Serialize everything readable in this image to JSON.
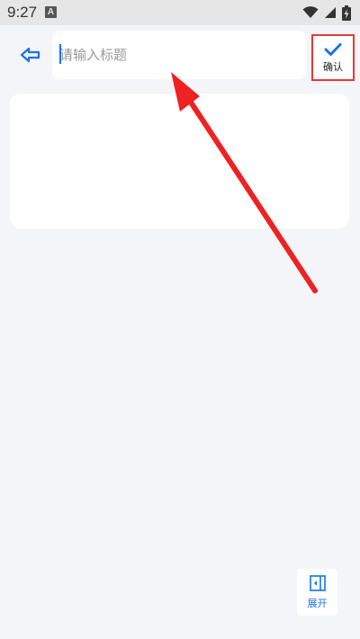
{
  "status_bar": {
    "time": "9:27",
    "notification_icon": "A",
    "icons": [
      "wifi-icon",
      "signal-icon",
      "battery-icon"
    ]
  },
  "header": {
    "back_icon": "arrow-left-outline-icon",
    "title_placeholder": "请输入标题",
    "title_value": "",
    "confirm_icon": "checkmark-icon",
    "confirm_label": "确认"
  },
  "footer": {
    "expand_icon": "panel-expand-icon",
    "expand_label": "展开"
  },
  "colors": {
    "accent": "#1a73e8",
    "highlight": "#e53935",
    "background": "#f3f5f9"
  }
}
